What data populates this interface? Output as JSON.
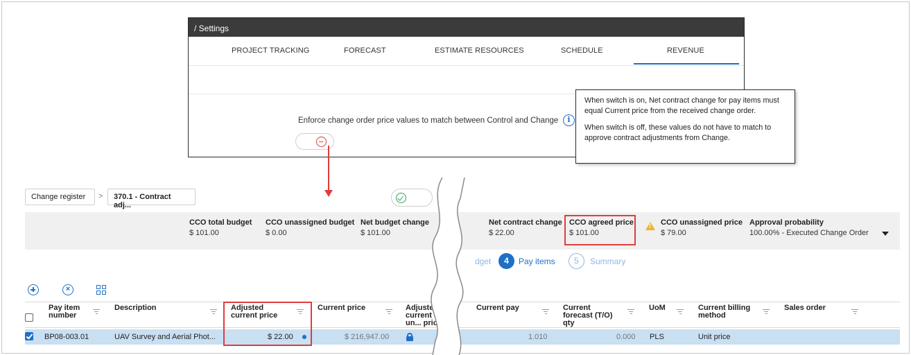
{
  "settings": {
    "title": "/ Settings",
    "tabs": [
      {
        "label": "PROJECT TRACKING"
      },
      {
        "label": "FORECAST"
      },
      {
        "label": "ESTIMATE RESOURCES"
      },
      {
        "label": "SCHEDULE"
      },
      {
        "label": "REVENUE",
        "active": true
      }
    ],
    "enforce_label": "Enforce change order price values to match between Control and Change",
    "info_icon": "info-icon",
    "switch_state": "off"
  },
  "tooltip": {
    "para1": "When switch is on, Net contract change for pay items must equal Current price from the received change order.",
    "para2": "When switch is off, these values do not have to match to approve contract adjustments from Change."
  },
  "breadcrumb": {
    "item1": "Change register",
    "separator": ">",
    "item2": "370.1 - Contract adj..."
  },
  "summary": {
    "items": [
      {
        "label": "CCO total budget",
        "value": "$ 101.00"
      },
      {
        "label": "CCO unassigned budget",
        "value": "$ 0.00"
      },
      {
        "label": "Net budget change",
        "value": "$ 101.00"
      },
      {
        "label": "N",
        "value": ""
      },
      {
        "label": "Net contract change",
        "value": "$ 22.00"
      },
      {
        "label": "CCO agreed price",
        "value": "$ 101.00"
      },
      {
        "label": "CCO unassigned price",
        "value": "$ 79.00"
      },
      {
        "label": "Approval probability",
        "value": "100.00% - Executed Change Order"
      }
    ]
  },
  "steps": {
    "prev_partial": "dget",
    "current_number": "4",
    "current_label": "Pay items",
    "next_number": "5",
    "next_label": "Summary"
  },
  "table": {
    "headers": {
      "pay_item_number": "Pay item number",
      "description": "Description",
      "adjusted_current_price": "Adjusted current price",
      "current_price": "Current price",
      "adjusted_current_unit_price": "Adjuste... current un... price",
      "current_pay": "Current pay",
      "current_forecast_qty": "Current forecast (T/O) qty",
      "uom": "UoM",
      "current_billing_method": "Current billing method",
      "sales_order": "Sales order"
    },
    "row": {
      "pay_item_number": "BP08-003.01",
      "description": "UAV Survey and Aerial Phot...",
      "adjusted_current_price": "$ 22.00",
      "current_price": "$ 216,947.00",
      "current_pay": "1.010",
      "current_forecast_qty": "0.000",
      "uom": "PLS",
      "current_billing_method": "Unit price",
      "sales_order": ""
    }
  },
  "colors": {
    "accent": "#1f6fc5",
    "highlight": "#e03c3c",
    "selected_row": "#c9dff2",
    "warning": "#f0b429"
  }
}
